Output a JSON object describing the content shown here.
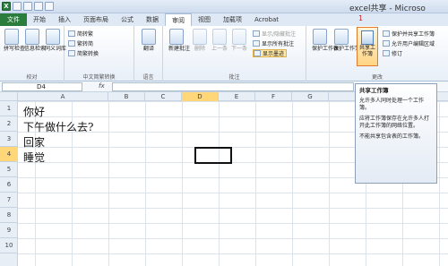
{
  "window": {
    "title": "excel共享 - Microso"
  },
  "tabs": [
    "文件",
    "开始",
    "插入",
    "页面布局",
    "公式",
    "数据",
    "审阅",
    "视图",
    "加载项",
    "Acrobat"
  ],
  "ribbon": {
    "proofing": {
      "spell": "拼写检查",
      "research": "信息检索",
      "thesaurus": "同义词库",
      "label": "校对"
    },
    "chinese": {
      "to_trad": "简转繁",
      "to_simp": "繁转简",
      "convert": "简繁转换",
      "label": "中文简繁转换"
    },
    "language": {
      "translate": "翻译",
      "label": "语言"
    },
    "comments": {
      "new": "新建批注",
      "delete": "删除",
      "prev": "上一条",
      "next": "下一条",
      "show_hide": "显示/隐藏批注",
      "show_all": "显示所有批注",
      "show_ink": "显示墨迹",
      "label": "批注"
    },
    "changes": {
      "protect_sheet": "保护工作表",
      "protect_book": "保护工作簿",
      "share_book": "共享工作簿",
      "protect_share": "保护并共享工作簿",
      "allow_edit": "允许用户编辑区域",
      "track": "修订",
      "label": "更改",
      "marker": "1"
    }
  },
  "formula_bar": {
    "name_box": "D4",
    "fx": "fx",
    "content": ""
  },
  "columns": [
    "A",
    "B",
    "C",
    "D",
    "E",
    "F",
    "G"
  ],
  "rows": [
    "1",
    "2",
    "3",
    "4",
    "5",
    "6",
    "7",
    "8",
    "9",
    "10"
  ],
  "cells": [
    "你好",
    "下午做什么去?",
    "回家",
    "睡觉"
  ],
  "tooltip": {
    "title": "共享工作簿",
    "p1": "允许多人同时处理一个工作簿。",
    "p2": "应将工作簿保存在允许多人打开此工作簿的网络位置。",
    "p3": "不能共享包含表的工作簿。"
  }
}
